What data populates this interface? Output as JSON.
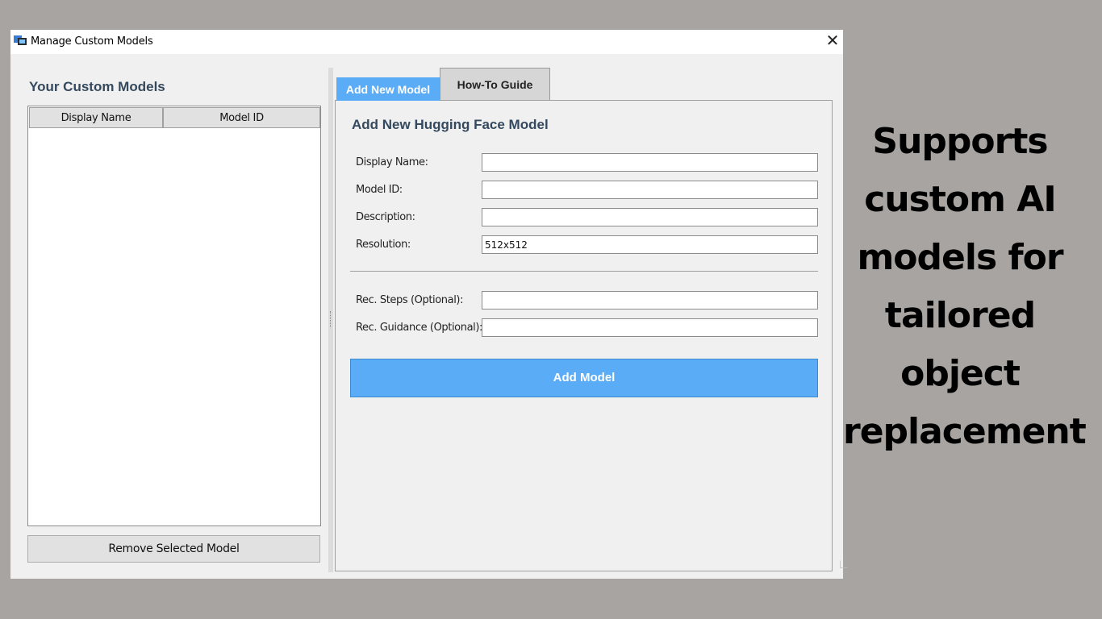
{
  "window": {
    "title": "Manage Custom Models",
    "close_label": "✕",
    "icon": "app-icon"
  },
  "left_panel": {
    "heading": "Your Custom Models",
    "columns": [
      "Display Name",
      "Model ID"
    ],
    "rows": [],
    "remove_button": "Remove Selected Model"
  },
  "tabs": [
    {
      "label": "Add New Model",
      "active": true
    },
    {
      "label": "How-To Guide",
      "active": false
    }
  ],
  "form": {
    "heading": "Add New Hugging Face Model",
    "fields": [
      {
        "label": "Display Name:",
        "value": ""
      },
      {
        "label": "Model ID:",
        "value": ""
      },
      {
        "label": "Description:",
        "value": ""
      },
      {
        "label": "Resolution:",
        "value": "512x512"
      },
      {
        "label": "Rec. Steps (Optional):",
        "value": ""
      },
      {
        "label": "Rec. Guidance (Optional):",
        "value": ""
      }
    ],
    "submit_button": "Add Model"
  },
  "caption": "Supports custom AI models for tailored object replacement",
  "colors": {
    "accent": "#5aacf6",
    "heading": "#34495e",
    "background": "#a8a4a1"
  }
}
